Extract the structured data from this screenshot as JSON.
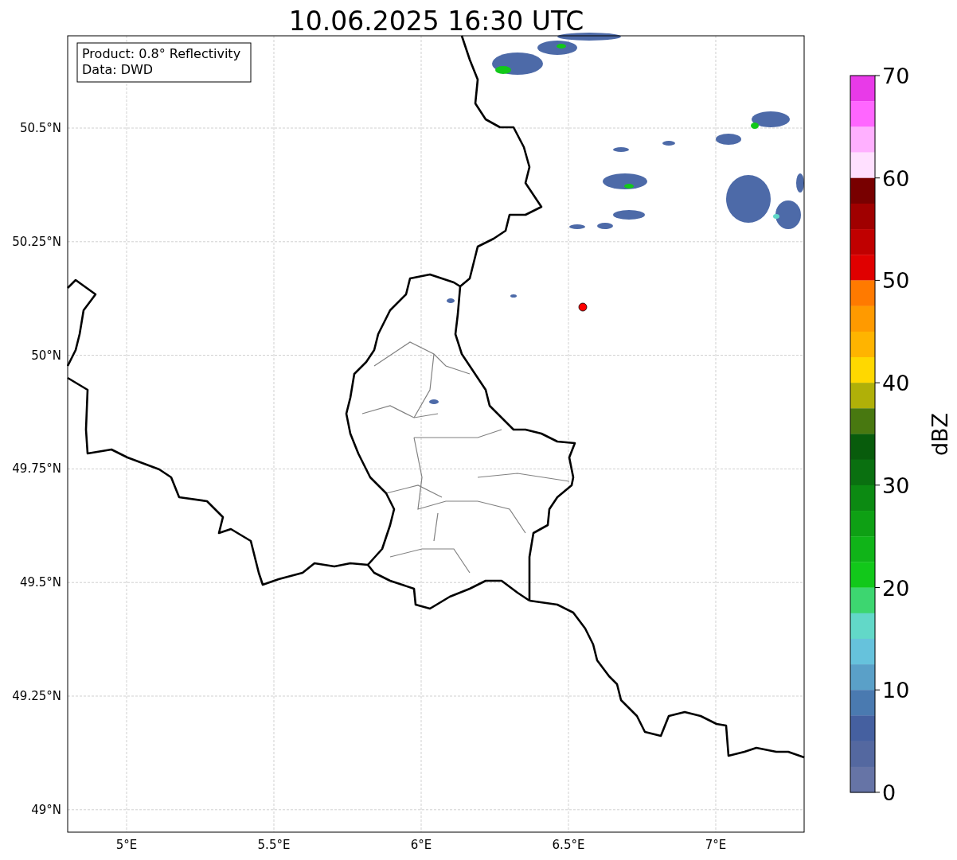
{
  "title": "10.06.2025 16:30 UTC",
  "info_box": {
    "lines": [
      "Product: 0.8° Reflectivity",
      "Data: DWD"
    ]
  },
  "map": {
    "x_ticks": [
      "5°E",
      "5.5°E",
      "6°E",
      "6.5°E",
      "7°E"
    ],
    "y_ticks": [
      "50.5°N",
      "50.25°N",
      "50°N",
      "49.75°N",
      "49.5°N",
      "49.25°N",
      "49°N"
    ]
  },
  "colorbar": {
    "label": "dBZ",
    "ticks": [
      "70",
      "60",
      "50",
      "40",
      "30",
      "20",
      "10",
      "0"
    ],
    "segments": [
      {
        "color": "#e83ae8"
      },
      {
        "color": "#ff66ff"
      },
      {
        "color": "#ffb0ff"
      },
      {
        "color": "#ffe0ff"
      },
      {
        "color": "#780000"
      },
      {
        "color": "#a00000"
      },
      {
        "color": "#c00000"
      },
      {
        "color": "#e00000"
      },
      {
        "color": "#ff7a00"
      },
      {
        "color": "#ff9a00"
      },
      {
        "color": "#ffb400"
      },
      {
        "color": "#ffd800"
      },
      {
        "color": "#b0b008"
      },
      {
        "color": "#487810"
      },
      {
        "color": "#085c0c"
      },
      {
        "color": "#0a7010"
      },
      {
        "color": "#0c8a12"
      },
      {
        "color": "#0ea014"
      },
      {
        "color": "#10b418"
      },
      {
        "color": "#12c81a"
      },
      {
        "color": "#3dd670"
      },
      {
        "color": "#62d8c8"
      },
      {
        "color": "#66c2dc"
      },
      {
        "color": "#5aa0c8"
      },
      {
        "color": "#4a7ab0"
      },
      {
        "color": "#4560a0"
      },
      {
        "color": "#5468a0"
      },
      {
        "color": "#6674a6"
      }
    ]
  }
}
